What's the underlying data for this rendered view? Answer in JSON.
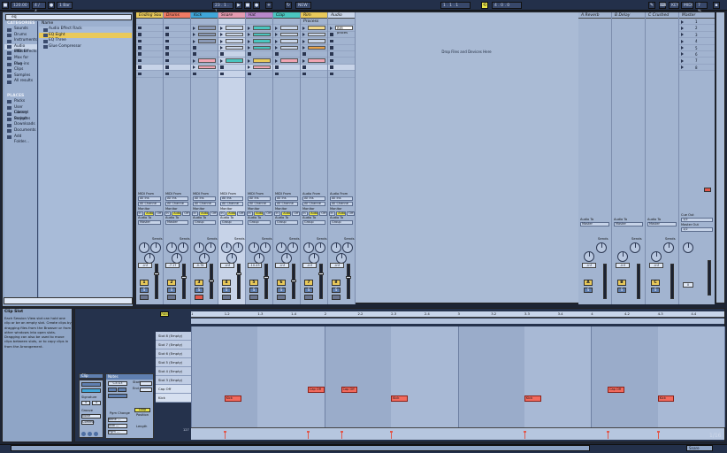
{
  "transport": {
    "tempo": "120.00",
    "signature": "4 / 4",
    "quantize": "1 Bar",
    "position": "23 . 1 . 1",
    "loop_start": "1 . 1 . 1",
    "loop_length": "4 . 0 . 0",
    "mode": "NEW",
    "key": "KEY",
    "midi": "MIDI",
    "cpu": "7 %"
  },
  "browser": {
    "search_value": "eq",
    "categories_header": "CATEGORIES",
    "categories": [
      "Sounds",
      "Drums",
      "Instruments",
      "Audio Effects",
      "MIDI Effects",
      "Max for Live",
      "Plug-ins",
      "Clips",
      "Samples",
      "All results"
    ],
    "selected_category": 3,
    "places_header": "PLACES",
    "places": [
      "Packs",
      "User Library",
      "Current Project",
      "Samples",
      "Downloads",
      "Documents",
      "Add Folder..."
    ],
    "name_header": "Name",
    "files": [
      "Audio Effect Rack",
      "EQ Eight",
      "EQ Three",
      "Glue Compressor"
    ],
    "selected_file": 1
  },
  "session": {
    "tracks": [
      {
        "name": "Ending Sou",
        "color": "#e9c95a"
      },
      {
        "name": "Drums",
        "color": "#ef7a63"
      },
      {
        "name": "Kick",
        "color": "#3fa6d9"
      },
      {
        "name": "Snare",
        "color": "#e59bb0"
      },
      {
        "name": "Hat",
        "color": "#b787c9"
      },
      {
        "name": "Clap",
        "color": "#4ac6c0"
      },
      {
        "name": "Rim Process",
        "color": "#e9c95a"
      },
      {
        "name": "Audio",
        "color": "#c9d6ea"
      }
    ],
    "clip_label_audio": "RIM proces",
    "drop_text": "Drop Files and Devices Here",
    "returns": [
      "A Reverb",
      "B Delay",
      "C Crushed"
    ],
    "master": "Master",
    "scene_numbers": [
      "1",
      "2",
      "3",
      "4",
      "5",
      "6",
      "7",
      "8"
    ],
    "io": {
      "audio_from": "Audio From",
      "midi_from": "MIDI From",
      "ext_in": "Ext. In",
      "all_ins": "All Ins",
      "all_channels": "All Channe",
      "monitor": "Monitor",
      "in": "In",
      "auto": "Auto",
      "off": "Off",
      "audio_to": "Audio To",
      "group": "Group",
      "master": "Master",
      "cue_out": "Cue Out",
      "master_out": "Master Out",
      "cue_val": "1/2"
    },
    "sends_label": "Sends",
    "volume_values": [
      "-inf",
      "-7.17",
      "-0.78",
      "-inf",
      "-10.43",
      "-inf",
      "-inf",
      "-inf"
    ],
    "track_numbers": [
      "1",
      "2",
      "3",
      "4",
      "5",
      "6",
      "7",
      "8"
    ],
    "return_letters": [
      "A",
      "B",
      "C"
    ],
    "return_volumes": [
      "-inf",
      "-inf",
      "-inf"
    ],
    "master_volume": "0",
    "solo": "S",
    "scale_marks": [
      "0",
      "6",
      "12",
      "24",
      "36",
      "48",
      "60"
    ]
  },
  "info": {
    "title": "Clip Slot",
    "text": "Each Session View slot can hold one clip or be an empty slot. Create clips by dragging files from the Browser or from other windows into open slots. Dragging can also be used to move clips between slots, or to copy clips in from the Arrangement."
  },
  "clip_detail": {
    "clip_label": "Clip",
    "notes_label": "Notes",
    "start": "Start",
    "end": "End",
    "signature": "Signature",
    "groove": "Groove",
    "commit": "Commit",
    "none": "None",
    "pgm_change": "Pgm Change",
    "bank": "Bank ---",
    "sub": "Sub ---",
    "pgm": "Pgm ---",
    "position": "Position",
    "length": "Length",
    "loop": "Loop",
    "fold": "Fold",
    "ruler": [
      "1",
      "1.2",
      "1.3",
      "1.4",
      "2",
      "2.2",
      "2.3",
      "2.4",
      "3",
      "3.2",
      "3.3",
      "3.4",
      "4",
      "4.2",
      "4.3",
      "4.4"
    ],
    "rows": [
      "Slot 8 (Empty)",
      "Slot 7 (Empty)",
      "Slot 6 (Empty)",
      "Slot 5 (Empty)",
      "Slot 4 (Empty)",
      "Slot 3 (Empty)",
      "Cap Off",
      "Kick"
    ],
    "notes": [
      {
        "label": "Kick",
        "row": 7,
        "start": 0.5,
        "len": 0.25
      },
      {
        "label": "Cap Off",
        "row": 6,
        "start": 1.75,
        "len": 0.25
      },
      {
        "label": "Cap Off",
        "row": 6,
        "start": 2.25,
        "len": 0.25
      },
      {
        "label": "Kick",
        "row": 7,
        "start": 3.0,
        "len": 0.25
      },
      {
        "label": "Kick",
        "row": 7,
        "start": 5.0,
        "len": 0.25
      },
      {
        "label": "Cap Off",
        "row": 6,
        "start": 6.25,
        "len": 0.25
      },
      {
        "label": "Kick",
        "row": 7,
        "start": 7.0,
        "len": 0.25
      }
    ],
    "velocity_top": "127",
    "velocity_bottom": "1",
    "page": "1/16"
  },
  "status": {
    "track_label": "Snare"
  }
}
